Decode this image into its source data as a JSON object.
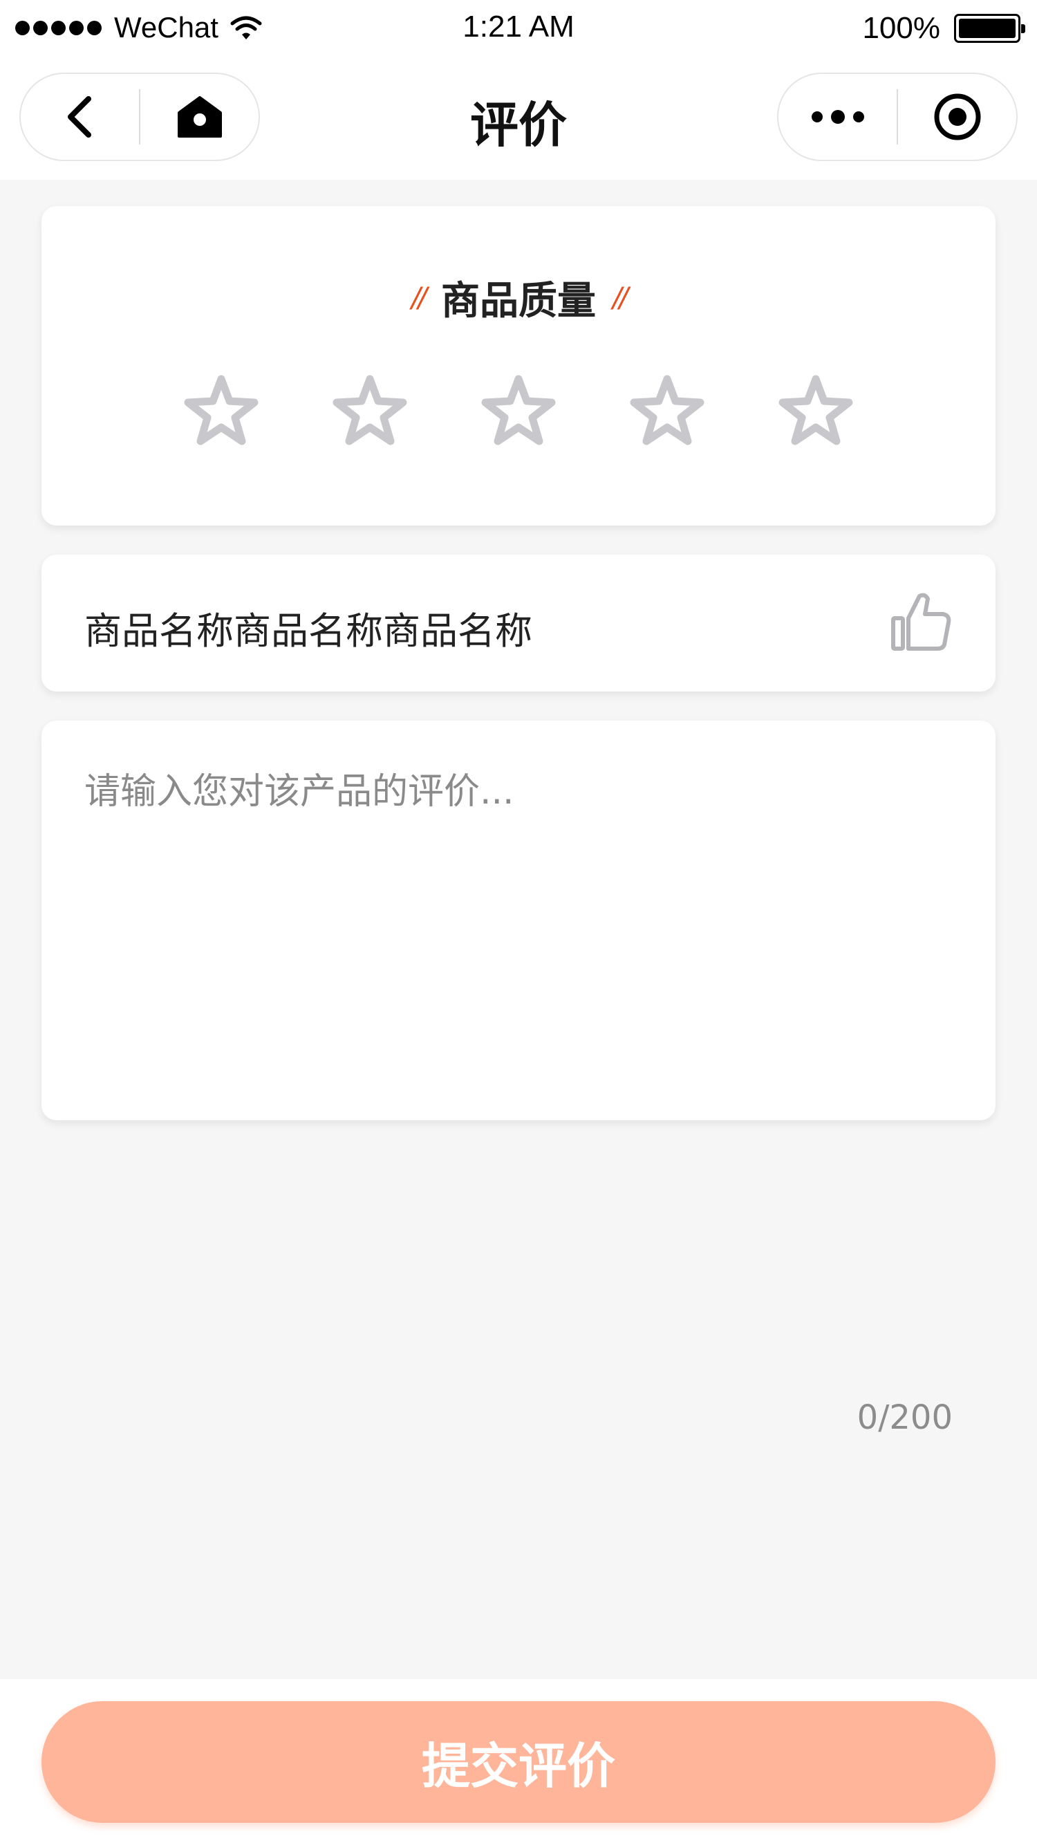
{
  "status_bar": {
    "carrier": "WeChat",
    "time": "1:21 AM",
    "battery": "100%"
  },
  "nav": {
    "title": "评价",
    "icons": [
      "back-icon",
      "home-icon",
      "more-icon",
      "close-mini-program-icon"
    ]
  },
  "quality": {
    "title": "商品质量",
    "slash_left": "//",
    "slash_right": "//",
    "star_count": 5,
    "rating": 0
  },
  "product": {
    "name": "商品名称商品名称商品名称",
    "icon": "thumbs-up-icon"
  },
  "comment": {
    "placeholder": "请输入您对该产品的评价...",
    "value": "",
    "counter": "0/200"
  },
  "submit": {
    "label": "提交评价"
  },
  "colors": {
    "accent": "#e8501f",
    "button": "#ffb59a",
    "star": "#c8c8cc",
    "background": "#f6f6f6"
  }
}
